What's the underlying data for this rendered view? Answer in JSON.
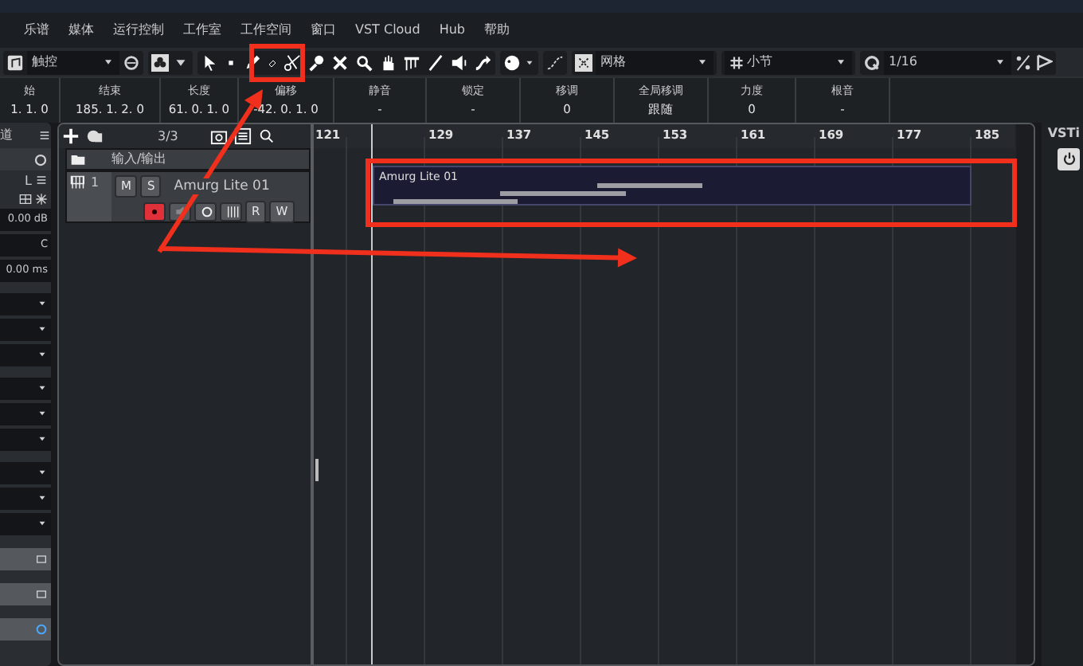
{
  "menu": [
    {
      "label": "乐谱"
    },
    {
      "label": "媒体"
    },
    {
      "label": "运行控制"
    },
    {
      "label": "工作室"
    },
    {
      "label": "工作空间"
    },
    {
      "label": "窗口"
    },
    {
      "label": "VST Cloud"
    },
    {
      "label": "Hub"
    },
    {
      "label": "帮助"
    }
  ],
  "toolbar": {
    "mode": "触控",
    "grid": "网格",
    "grid_type": "小节",
    "quantize": "1/16"
  },
  "infoline": [
    {
      "label": "始",
      "value": "1. 1. 0"
    },
    {
      "label": "结束",
      "value": "185. 1. 2. 0"
    },
    {
      "label": "长度",
      "value": "61. 0. 1. 0"
    },
    {
      "label": "偏移",
      "value": "-42. 0. 1. 0"
    },
    {
      "label": "静音",
      "value": "-"
    },
    {
      "label": "锁定",
      "value": "-"
    },
    {
      "label": "移调",
      "value": "0"
    },
    {
      "label": "全局移调",
      "value": "跟随"
    },
    {
      "label": "力度",
      "value": "0"
    },
    {
      "label": "根音",
      "value": "-"
    }
  ],
  "inspector": {
    "title": "道",
    "lock": "L",
    "fields": [
      "0.00 dB",
      "C",
      "0.00 ms"
    ]
  },
  "track_list": {
    "counter": "3/3"
  },
  "tracks": [
    {
      "kind": "folder",
      "name": "输入/输出"
    },
    {
      "kind": "instrument",
      "number": "1",
      "name": "Amurg Lite 01",
      "mute": "M",
      "solo": "S",
      "read": "R",
      "write": "W",
      "record": true
    }
  ],
  "ruler": [
    "121",
    "129",
    "137",
    "145",
    "153",
    "161",
    "169",
    "177",
    "185"
  ],
  "part": {
    "name": "Amurg Lite 01"
  },
  "right_panel": {
    "title": "VSTi"
  },
  "annotations": [
    {
      "kind": "box"
    },
    {
      "kind": "box"
    },
    {
      "kind": "arrow"
    },
    {
      "kind": "arrow"
    }
  ]
}
